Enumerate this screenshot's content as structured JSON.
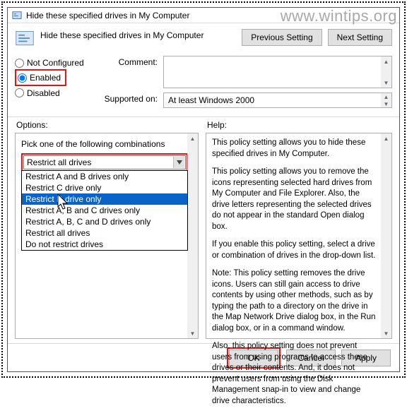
{
  "watermark": "www.wintips.org",
  "title": "Hide these specified drives in My Computer",
  "headerTitle": "Hide these specified drives in My Computer",
  "nav": {
    "prev": "Previous Setting",
    "next": "Next Setting"
  },
  "radios": {
    "notConfigured": "Not Configured",
    "enabled": "Enabled",
    "disabled": "Disabled",
    "selected": "enabled"
  },
  "commentLabel": "Comment:",
  "commentValue": "",
  "supportedLabel": "Supported on:",
  "supportedValue": "At least Windows 2000",
  "optionsLabel": "Options:",
  "helpLabel": "Help:",
  "optionsPrompt": "Pick one of the following combinations",
  "combo": {
    "selected": "Restrict all drives",
    "highlighted": "Restrict D drive only",
    "items": [
      "Restrict A and B drives only",
      "Restrict C drive only",
      "Restrict D drive only",
      "Restrict A, B and C drives only",
      "Restrict A, B, C and D drives only",
      "Restrict all drives",
      "Do not restrict drives"
    ]
  },
  "help": {
    "p1": "This policy setting allows you to hide these specified drives in My Computer.",
    "p2": "This policy setting allows you to remove the icons representing selected hard drives from My Computer and File Explorer. Also, the drive letters representing the selected drives do not appear in the standard Open dialog box.",
    "p3": "If you enable this policy setting, select a drive or combination of drives in the drop-down list.",
    "p4": "Note: This policy setting removes the drive icons. Users can still gain access to drive contents by using other methods, such as by typing the path to a directory on the drive in the Map Network Drive dialog box, in the Run dialog box, or in a command window.",
    "p5": "Also, this policy setting does not prevent users from using programs to access these drives or their contents. And, it does not prevent users from using the Disk Management snap-in to view and change drive characteristics."
  },
  "buttons": {
    "ok": "OK",
    "cancel": "Cancel",
    "apply": "Apply"
  }
}
